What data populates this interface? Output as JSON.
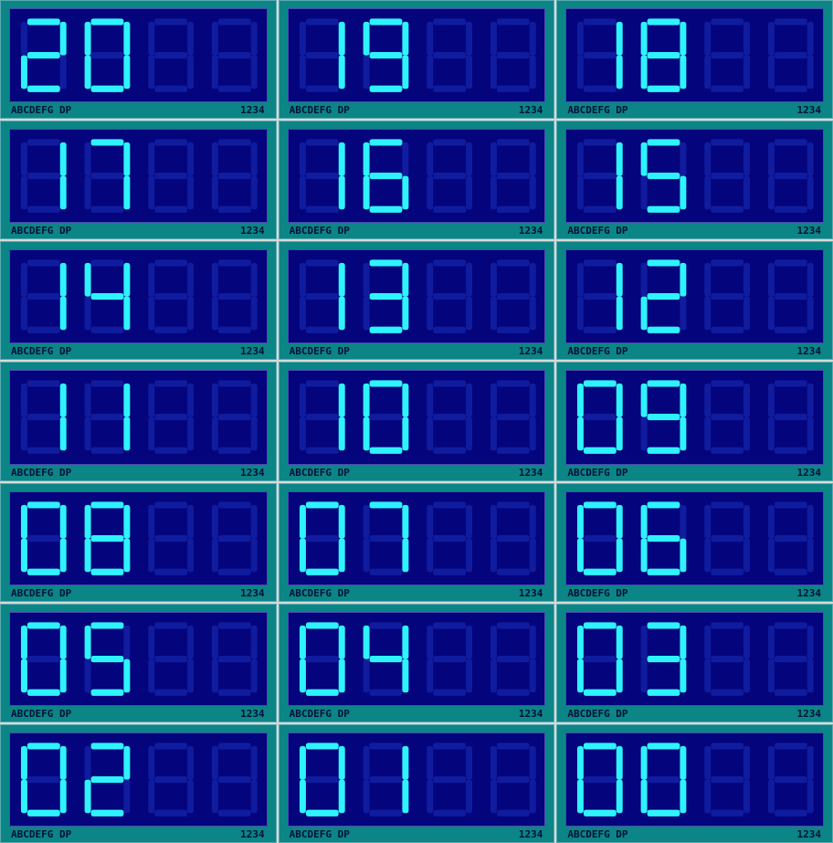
{
  "colors": {
    "segment_on": "#2ef3ff",
    "segment_off": "#101c9e",
    "screen": "#04047d",
    "frame": "#0b8585"
  },
  "caption_left": "ABCDEFG DP",
  "caption_right": "1234",
  "displays": [
    {
      "value": "20"
    },
    {
      "value": "19"
    },
    {
      "value": "18"
    },
    {
      "value": "17"
    },
    {
      "value": "16"
    },
    {
      "value": "15"
    },
    {
      "value": "14"
    },
    {
      "value": "13"
    },
    {
      "value": "12"
    },
    {
      "value": "11"
    },
    {
      "value": "10"
    },
    {
      "value": "09"
    },
    {
      "value": "08"
    },
    {
      "value": "07"
    },
    {
      "value": "06"
    },
    {
      "value": "05"
    },
    {
      "value": "04"
    },
    {
      "value": "03"
    },
    {
      "value": "02"
    },
    {
      "value": "01"
    },
    {
      "value": "00"
    }
  ]
}
